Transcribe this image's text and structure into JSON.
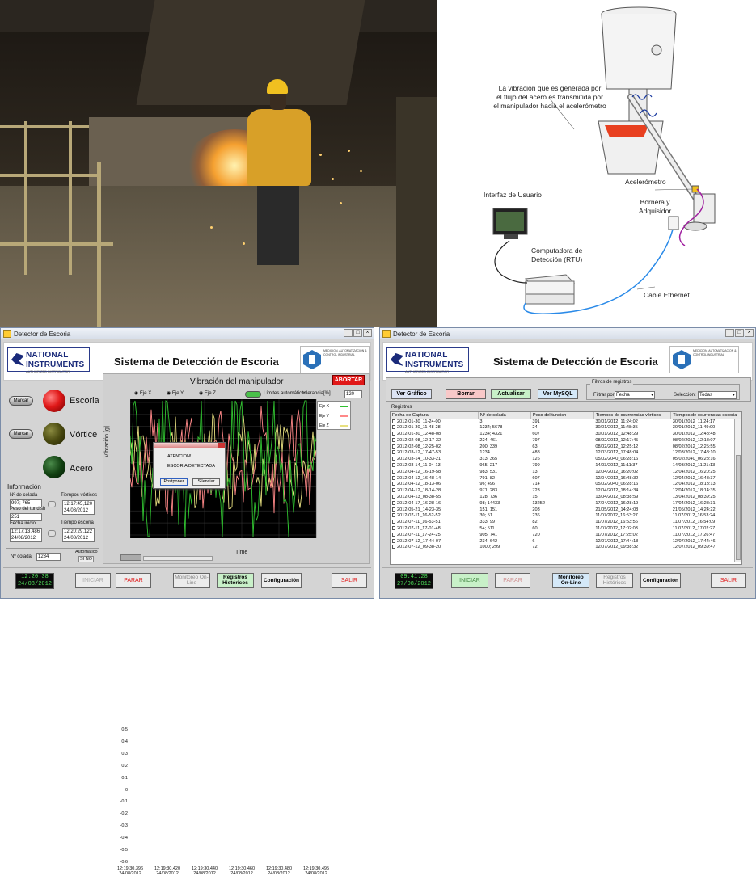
{
  "diagram": {
    "vibration_note": [
      "La vibración que es generada por",
      "el flujo del acero es transmitida por",
      "el manipulador hacia el acelerómetro"
    ],
    "accelerometer": "Acelerómetro",
    "terminal": [
      "Bornera y",
      "Adquisidor"
    ],
    "ui": "Interfaz de Usuario",
    "rtu": [
      "Computadora de",
      "Detección (RTU)"
    ],
    "ethernet": "Cable Ethernet"
  },
  "left": {
    "window_title": "Detector de Escoria",
    "app_title": "Sistema de Detección de Escoria",
    "ni_logo": [
      "NATIONAL",
      "INSTRUMENTS",
      "AUTHORIZED DISTRIBUTOR"
    ],
    "partner_text": "MEDICION, AUTOMATIZACION & CONTROL INDUSTRIAL",
    "marcar": "Marcar",
    "status": {
      "escoria": "Escoria",
      "vortice": "Vórtice",
      "acero": "Acero"
    },
    "chart_title": "Vibración del manipulador",
    "abort": "ABORTAR",
    "axes_toggle": [
      "Eje X",
      "Eje Y",
      "Eje Z"
    ],
    "auto_limits": "Límites automáticos",
    "tolerance_label": "tolerancia[%]",
    "tolerance_value": "120",
    "legend": [
      "Eje X",
      "Eje Y",
      "Eje Z"
    ],
    "xlabel": "Time",
    "ylabel": "Vibración [g]",
    "yticks": [
      "0.5",
      "0.4",
      "0.3",
      "0.2",
      "0.1",
      "0",
      "-0.1",
      "-0.2",
      "-0.3",
      "-0.4",
      "-0.5",
      "-0.6"
    ],
    "xticks": [
      [
        "12:19:30,396",
        "24/08/2012"
      ],
      [
        "12:19:30,420",
        "24/08/2012"
      ],
      [
        "12:19:30,440",
        "24/08/2012"
      ],
      [
        "12:19:30,460",
        "24/08/2012"
      ],
      [
        "12:19:30,480",
        "24/08/2012"
      ],
      [
        "12:19:30,495",
        "24/08/2012"
      ]
    ],
    "info": {
      "title": "Información",
      "colada_label": "Nº de colada",
      "colada_value": "997; 765",
      "peso_label": "Peso del tundish",
      "peso_value": "251",
      "fecha_label": "Fecha inicio",
      "fecha_value": "12:17:13,486",
      "fecha_date": "24/08/2012",
      "tv_label": "Tiempos vórtices",
      "tv_value": "12:17:45,120",
      "tv_date": "24/08/2012",
      "te_label": "Tiempo escoria",
      "te_value": "12:20:29,122",
      "te_date": "24/08/2012"
    },
    "ncolada_label": "Nº colada:",
    "ncolada_value": "1234",
    "auto_label": "Automático",
    "auto_toggle": "SI NO",
    "dialog": {
      "title": "ATENCION!",
      "message": "ESCORIA DETECTADA",
      "postpone": "Postponer",
      "silence": "Silenciar"
    },
    "clock_time": "12:20:38",
    "clock_date": "24/08/2012",
    "buttons": {
      "iniciar": "INICIAR",
      "parar": "PARAR",
      "monitoreo": "Monitoreo On-Line",
      "registros": "Registros Históricos",
      "config": "Configuración",
      "salir": "SALIR"
    }
  },
  "right": {
    "window_title": "Detector de Escoria",
    "app_title": "Sistema de Detección de Escoria",
    "buttons": {
      "grafico": "Ver Gráfico",
      "borrar": "Borrar",
      "actualizar": "Actualizar",
      "mysql": "Ver MySQL"
    },
    "filters_title": "Filtros de registros",
    "filter_by_label": "Filtrar por:",
    "filter_by_value": "Fecha",
    "selection_label": "Selección:",
    "selection_value": "Todas",
    "registros_label": "Registros",
    "columns": [
      "Fecha de Captura",
      "Nº de colada",
      "Peso del tundish",
      "Tiempos de ocurrencias vórtices",
      "Tiempos de ocurrencias escoria"
    ],
    "rows": [
      [
        "2012-01-30_11-24-00",
        "3",
        "391",
        "30/01/2012_11:24:02",
        "30/01/2012_11:24:17"
      ],
      [
        "2012-01-30_11-48-28",
        "1234; 5678",
        "24",
        "30/01/2012_11:48:35",
        "30/01/2012_11:49:00"
      ],
      [
        "2012-01-30_12-48-08",
        "1234; 4321",
        "607",
        "30/01/2012_12:48:29",
        "30/01/2012_12:48:48"
      ],
      [
        "2012-02-08_12-17-32",
        "224; 461",
        "797",
        "08/02/2012_12:17:45",
        "08/02/2012_12:18:07"
      ],
      [
        "2012-02-08_12-25-02",
        "200; 339",
        "63",
        "08/02/2012_12:25:12",
        "08/02/2012_12:25:55"
      ],
      [
        "2012-03-12_17-47-53",
        "1234",
        "488",
        "12/03/2012_17:48:04",
        "12/03/2012_17:48:10"
      ],
      [
        "2012-03-14_10-33-21",
        "313; 365",
        "126",
        "05/02/2040_06:28:16",
        "05/02/2040_06:28:16"
      ],
      [
        "2012-03-14_11-04-13",
        "965; 217",
        "799",
        "14/03/2012_11:11:37",
        "14/03/2012_11:21:13"
      ],
      [
        "2012-04-12_16-19-58",
        "983; 531",
        "13",
        "12/04/2012_16:20:02",
        "12/04/2012_16:20:25"
      ],
      [
        "2012-04-12_16-48-14",
        "791; 82",
        "607",
        "12/04/2012_16:48:32",
        "12/04/2012_16:48:37"
      ],
      [
        "2012-04-12_18-13-06",
        "96; 496",
        "714",
        "05/02/2040_06:28:16",
        "12/04/2012_18:13:13"
      ],
      [
        "2012-04-12_18-14-28",
        "971; 283",
        "723",
        "12/04/2012_18:14:34",
        "12/04/2012_18:14:35"
      ],
      [
        "2012-04-13_08-38-55",
        "128; 736",
        "15",
        "13/04/2012_08:38:59",
        "13/04/2012_08:39:25"
      ],
      [
        "2012-04-17_16-28-16",
        "98; 14433",
        "13252",
        "17/04/2012_16:28:19",
        "17/04/2012_16:28:31"
      ],
      [
        "2012-05-21_14-23-35",
        "151; 151",
        "203",
        "21/05/2012_14:24:08",
        "21/05/2012_14:24:22"
      ],
      [
        "2012-07-11_16-52-52",
        "30; 51",
        "236",
        "11/07/2012_16:53:27",
        "11/07/2012_16:53:24"
      ],
      [
        "2012-07-11_16-53-51",
        "333; 99",
        "82",
        "11/07/2012_16:53:56",
        "11/07/2012_16:54:09"
      ],
      [
        "2012-07-11_17-01-48",
        "54; 511",
        "60",
        "11/07/2012_17:02:03",
        "11/07/2012_17:02:27"
      ],
      [
        "2012-07-11_17-24-25",
        "905; 741",
        "720",
        "11/07/2012_17:25:02",
        "11/07/2012_17:26:47"
      ],
      [
        "2012-07-12_17-44-07",
        "234; 642",
        "6",
        "12/07/2012_17:44:18",
        "12/07/2012_17:44:46"
      ],
      [
        "2012-07-12_09-38-20",
        "1000; 299",
        "72",
        "12/07/2012_09:38:32",
        "12/07/2012_09:39:47"
      ]
    ],
    "clock_time": "09:41:28",
    "clock_date": "27/08/2012",
    "bottom": {
      "iniciar": "INICIAR",
      "parar": "PARAR",
      "monitoreo": "Monitoreo On-Line",
      "registros": "Registros Históricos",
      "config": "Configuración",
      "salir": "SALIR"
    }
  },
  "colors": {
    "red_led": "#e01818",
    "dark_olive_led": "#4a4a10",
    "dark_green_led": "#124212",
    "trace_green": "#30c030",
    "trace_pink": "#ff8888",
    "trace_yellow": "#e8e080"
  }
}
